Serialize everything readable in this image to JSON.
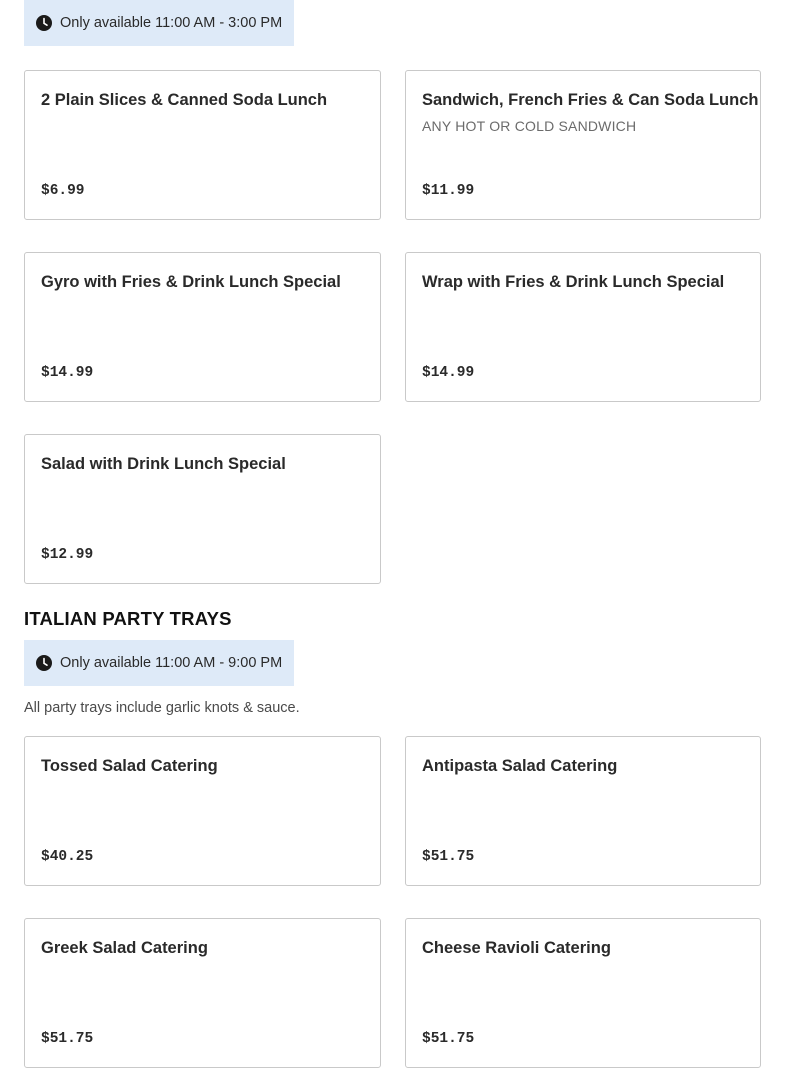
{
  "lunch_section": {
    "availability": "Only available 11:00 AM - 3:00 PM",
    "items": [
      {
        "name": "2 Plain Slices & Canned Soda Lunch",
        "description": "",
        "price": "$6.99"
      },
      {
        "name": "Sandwich, French Fries & Can Soda Lunch",
        "description": "ANY HOT OR COLD SANDWICH",
        "price": "$11.99"
      },
      {
        "name": "Gyro with Fries & Drink Lunch Special",
        "description": "",
        "price": "$14.99"
      },
      {
        "name": "Wrap with Fries & Drink Lunch Special",
        "description": "",
        "price": "$14.99"
      },
      {
        "name": "Salad with Drink Lunch Special",
        "description": "",
        "price": "$12.99"
      }
    ]
  },
  "party_trays_section": {
    "title": "ITALIAN PARTY TRAYS",
    "availability": "Only available 11:00 AM - 9:00 PM",
    "note": "All party trays include garlic knots & sauce.",
    "items": [
      {
        "name": "Tossed Salad Catering",
        "price": "$40.25"
      },
      {
        "name": "Antipasta Salad Catering",
        "price": "$51.75"
      },
      {
        "name": "Greek Salad Catering",
        "price": "$51.75"
      },
      {
        "name": "Cheese Ravioli Catering",
        "price": "$51.75"
      }
    ]
  },
  "icons": {
    "availability_icon": "clock-icon"
  },
  "colors": {
    "availability_bg": "#deeaf8",
    "card_border": "#c9c9c9",
    "text": "#2a2a2a"
  }
}
